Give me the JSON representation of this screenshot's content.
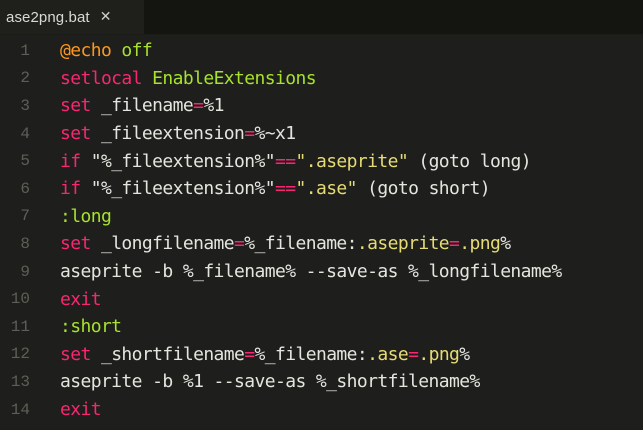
{
  "tab": {
    "title": "ase2png.bat",
    "close_icon": "close-icon"
  },
  "colors": {
    "background": "#1e1f1c",
    "keyword": "#f92672",
    "string": "#e6db74",
    "label": "#a6e22e",
    "variable": "#fd971f",
    "text": "#e5e5df",
    "gutter": "#5d5f57"
  },
  "lines": [
    {
      "number": "1",
      "tokens": [
        {
          "t": "@echo",
          "c": "ora"
        },
        {
          "t": " off",
          "c": "grn"
        }
      ]
    },
    {
      "number": "2",
      "tokens": [
        {
          "t": "setlocal",
          "c": "kw"
        },
        {
          "t": " EnableExtensions",
          "c": "grn"
        }
      ]
    },
    {
      "number": "3",
      "tokens": [
        {
          "t": "set",
          "c": "kw"
        },
        {
          "t": " _filename",
          "c": "wht"
        },
        {
          "t": "=",
          "c": "kw"
        },
        {
          "t": "%1",
          "c": "wht"
        }
      ]
    },
    {
      "number": "4",
      "tokens": [
        {
          "t": "set",
          "c": "kw"
        },
        {
          "t": " _fileextension",
          "c": "wht"
        },
        {
          "t": "=",
          "c": "kw"
        },
        {
          "t": "%~x1",
          "c": "wht"
        }
      ]
    },
    {
      "number": "5",
      "tokens": [
        {
          "t": "if",
          "c": "kw"
        },
        {
          "t": " \"%_fileextension%\"",
          "c": "wht"
        },
        {
          "t": "==",
          "c": "kw"
        },
        {
          "t": "\".aseprite\"",
          "c": "str"
        },
        {
          "t": " (goto long)",
          "c": "wht"
        }
      ]
    },
    {
      "number": "6",
      "tokens": [
        {
          "t": "if",
          "c": "kw"
        },
        {
          "t": " \"%_fileextension%\"",
          "c": "wht"
        },
        {
          "t": "==",
          "c": "kw"
        },
        {
          "t": "\".ase\"",
          "c": "str"
        },
        {
          "t": " (goto short)",
          "c": "wht"
        }
      ]
    },
    {
      "number": "7",
      "tokens": [
        {
          "t": ":long",
          "c": "grn"
        }
      ]
    },
    {
      "number": "8",
      "tokens": [
        {
          "t": "set",
          "c": "kw"
        },
        {
          "t": " _longfilename",
          "c": "wht"
        },
        {
          "t": "=",
          "c": "kw"
        },
        {
          "t": "%_filename:",
          "c": "wht"
        },
        {
          "t": ".aseprite",
          "c": "str"
        },
        {
          "t": "=",
          "c": "kw"
        },
        {
          "t": ".png",
          "c": "str"
        },
        {
          "t": "%",
          "c": "wht"
        }
      ]
    },
    {
      "number": "9",
      "tokens": [
        {
          "t": "aseprite -b %_filename% --save-as %_longfilename%",
          "c": "wht"
        }
      ]
    },
    {
      "number": "10",
      "tokens": [
        {
          "t": "exit",
          "c": "kw"
        }
      ]
    },
    {
      "number": "11",
      "tokens": [
        {
          "t": ":short",
          "c": "grn"
        }
      ]
    },
    {
      "number": "12",
      "tokens": [
        {
          "t": "set",
          "c": "kw"
        },
        {
          "t": " _shortfilename",
          "c": "wht"
        },
        {
          "t": "=",
          "c": "kw"
        },
        {
          "t": "%_filename:",
          "c": "wht"
        },
        {
          "t": ".ase",
          "c": "str"
        },
        {
          "t": "=",
          "c": "kw"
        },
        {
          "t": ".png",
          "c": "str"
        },
        {
          "t": "%",
          "c": "wht"
        }
      ]
    },
    {
      "number": "13",
      "tokens": [
        {
          "t": "aseprite -b %1 --save-as %_shortfilename%",
          "c": "wht"
        }
      ]
    },
    {
      "number": "14",
      "tokens": [
        {
          "t": "exit",
          "c": "kw"
        }
      ]
    }
  ]
}
